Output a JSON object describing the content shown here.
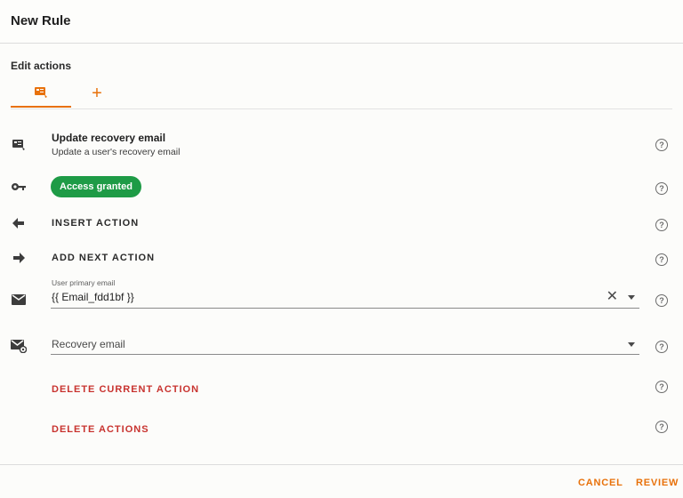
{
  "header": {
    "title": "New Rule"
  },
  "section": {
    "label": "Edit actions"
  },
  "tabs": [
    {
      "icon": "action-card-icon",
      "active": true
    },
    {
      "icon": "add-icon",
      "label": "+"
    }
  ],
  "action": {
    "title": "Update recovery email",
    "subtitle": "Update a user's recovery email"
  },
  "access": {
    "badge": "Access granted"
  },
  "buttons": {
    "insert": "INSERT ACTION",
    "add_next": "ADD NEXT ACTION",
    "delete_current": "DELETE CURRENT ACTION",
    "delete_all": "DELETE ACTIONS"
  },
  "fields": {
    "primary_email": {
      "label": "User primary email",
      "value": "{{ Email_fdd1bf }}"
    },
    "recovery_email": {
      "placeholder": "Recovery email"
    }
  },
  "help_glyph": "?",
  "clear_glyph": "✕",
  "footer": {
    "cancel": "CANCEL",
    "review": "REVIEW"
  },
  "colors": {
    "accent": "#e8710a",
    "success": "#1e9b46",
    "danger": "#c8332f"
  }
}
